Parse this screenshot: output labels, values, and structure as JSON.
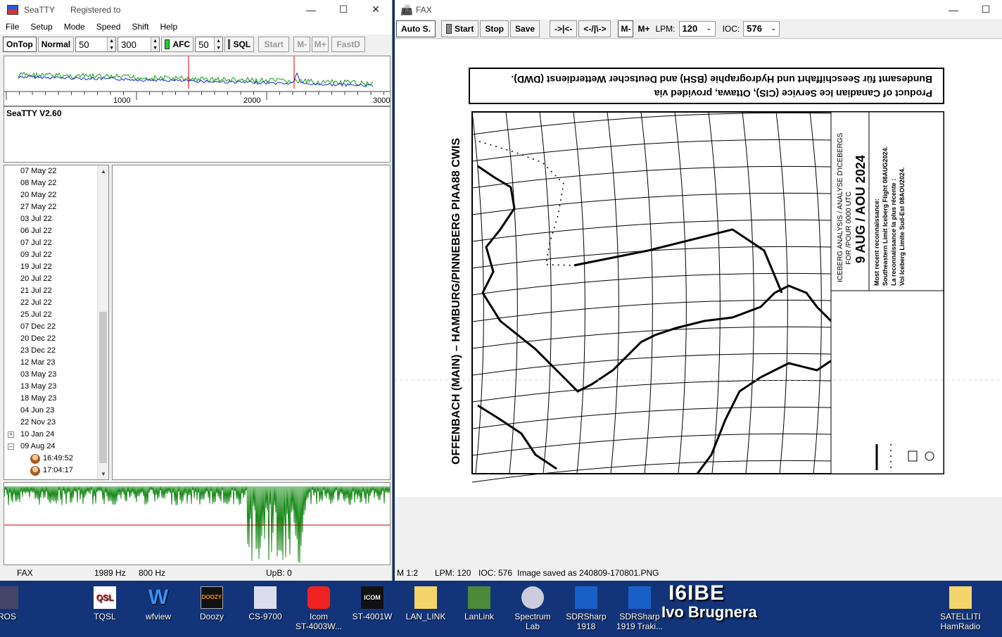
{
  "seatty": {
    "title": "SeaTTY",
    "registered": "Registered to",
    "menu": [
      "File",
      "Setup",
      "Mode",
      "Speed",
      "Shift",
      "Help"
    ],
    "toolbar": {
      "ontop": "OnTop",
      "normal": "Normal",
      "speed_value": "50",
      "shift_value": "300",
      "afc": "AFC",
      "sql_value": "50",
      "sql": "SQL",
      "start": "Start",
      "m_minus": "M-",
      "m_plus": "M+",
      "fastd": "FastD"
    },
    "spectrum_ticks": [
      "1000",
      "2000",
      "3000"
    ],
    "version": "SeaTTY V2.60",
    "log_dates": [
      "07 May 22",
      "08 May 22",
      "20 May 22",
      "27 May 22",
      "03 Jul 22",
      "06 Jul 22",
      "07 Jul 22",
      "09 Jul 22",
      "19 Jul 22",
      "20 Jul 22",
      "21 Jul 22",
      "22 Jul 22",
      "25 Jul 22",
      "07 Dec 22",
      "20 Dec 22",
      "23 Dec 22",
      "12 Mar 23",
      "03 May 23",
      "13 May 23",
      "18 May 23",
      "04 Jun 23",
      "22 Nov 23"
    ],
    "collapsed_node": "10 Jan 24",
    "expanded_node": "09 Aug 24",
    "expanded_children": [
      "16:49:52",
      "17:04:17"
    ],
    "status": {
      "mode": "FAX",
      "center": "1989 Hz",
      "shift": "800 Hz",
      "upb": "UpB: 0"
    }
  },
  "fax": {
    "title": "FAX",
    "toolbar": {
      "auto": "Auto S.",
      "start": "Start",
      "stop": "Stop",
      "save": "Save",
      "shift_right": "->|<-",
      "shift_left": "<-/|\\->",
      "m": "M-",
      "m_plus": "M+",
      "lpm_label": "LPM:",
      "lpm_value": "120",
      "ioc_label": "IOC:",
      "ioc_value": "576"
    },
    "image": {
      "header_line1": "Product of Canadian Ice Service (CIS), Ottawa, provided via",
      "header_line2": "Bundesamt für Seeschiffahrt und Hydrographie (BSH) and Deutscher Wetterdienst (DWD).",
      "station": "OFFENBACH (MAIN) – HAMBURG/PINNEBERG PIAA88 CWIS",
      "legend_title": "ICEBERG ANALYSIS / ANALYSE D'ICEBERGS",
      "legend_time": "FOR /POUR 0000 UTC",
      "legend_date": "9 AUG / AOU 2024",
      "legend_recon1": "Most recent reconnaissance:",
      "legend_recon2": "Southeastern Limit Iceberg Flight 08AUG2024.",
      "legend_recon3": "La reconnaissance la plus récente :",
      "legend_recon4": "Vol Iceberg Limite Sud-Est 08AOU2024."
    },
    "status": {
      "mode": "M 1:2",
      "lpm": "LPM: 120",
      "ioc": "IOC: 576",
      "saved": "Image saved as 240809-170801.PNG"
    }
  },
  "desktop": {
    "icons": [
      {
        "label": "ROS",
        "label2": ""
      },
      {
        "label": "TQSL",
        "label2": ""
      },
      {
        "label": "wfview",
        "label2": ""
      },
      {
        "label": "Doozy",
        "label2": ""
      },
      {
        "label": "CS-9700",
        "label2": ""
      },
      {
        "label": "Icom",
        "label2": "ST-4003W..."
      },
      {
        "label": "ST-4001W",
        "label2": ""
      },
      {
        "label": "LAN_LINK",
        "label2": ""
      },
      {
        "label": "LanLink",
        "label2": ""
      },
      {
        "label": "Spectrum",
        "label2": "Lab"
      },
      {
        "label": "SDRSharp",
        "label2": "1918"
      },
      {
        "label": "SDRSharp",
        "label2": "1919 Traki..."
      },
      {
        "label": "SATELLITI",
        "label2": "HamRadio"
      }
    ],
    "callsign": "I6IBE",
    "operator": "Ivo Brugnera"
  }
}
